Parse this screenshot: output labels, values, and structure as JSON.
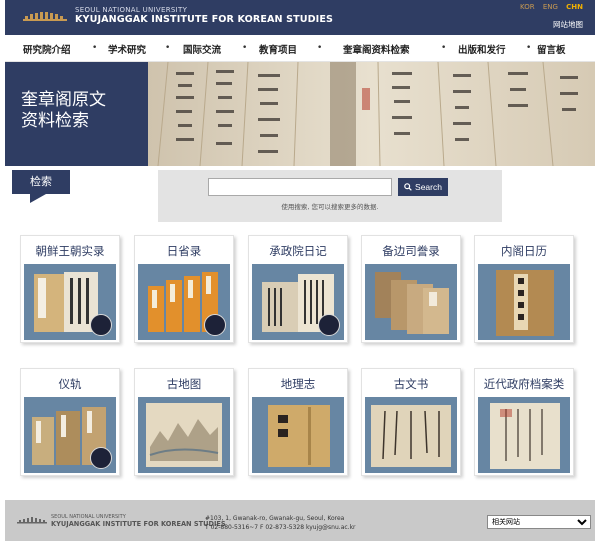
{
  "header": {
    "logo_line1": "SEOUL NATIONAL UNIVERSITY",
    "logo_line2": "KYUJANGGAK INSTITUTE FOR KOREAN STUDIES",
    "langs": [
      "KOR",
      "ENG",
      "CHN"
    ],
    "active_lang": "CHN",
    "sitemap": "网站地图"
  },
  "nav": {
    "items": [
      "研究院介绍",
      "学术研究",
      "国际交流",
      "教育项目",
      "奎章阁资料检索",
      "出版和发行",
      "留言板"
    ]
  },
  "banner": {
    "title_line1": "奎章阁原文",
    "title_line2": "资料检索"
  },
  "search": {
    "tab_label": "检索",
    "input_value": "",
    "button_label": "Search",
    "hint": "使用搜索, 您可以搜索更多的数据."
  },
  "cards": [
    {
      "title": "朝鲜王朝实录",
      "badge": true
    },
    {
      "title": "日省录",
      "badge": true
    },
    {
      "title": "承政院日记",
      "badge": true
    },
    {
      "title": "备边司誊录",
      "badge": false
    },
    {
      "title": "内阁日历",
      "badge": false
    },
    {
      "title": "仪轨",
      "badge": true
    },
    {
      "title": "古地图",
      "badge": false
    },
    {
      "title": "地理志",
      "badge": false
    },
    {
      "title": "古文书",
      "badge": false
    },
    {
      "title": "近代政府档案类",
      "badge": false
    }
  ],
  "footer": {
    "logo_line1": "SEOUL NATIONAL UNIVERSITY",
    "logo_line2": "KYUJANGGAK INSTITUTE FOR KOREAN STUDIES",
    "address": "#103, 1, Gwanak-ro, Gwanak-gu, Seoul, Korea",
    "contact": "T 02-880-5316~7   F 02-873-5328   kyujg@snu.ac.kr",
    "select_value": "相关网站"
  },
  "colors": {
    "brand": "#2f3d63",
    "lang_active": "#f0b000",
    "card_bg": "#6a8aa6"
  }
}
